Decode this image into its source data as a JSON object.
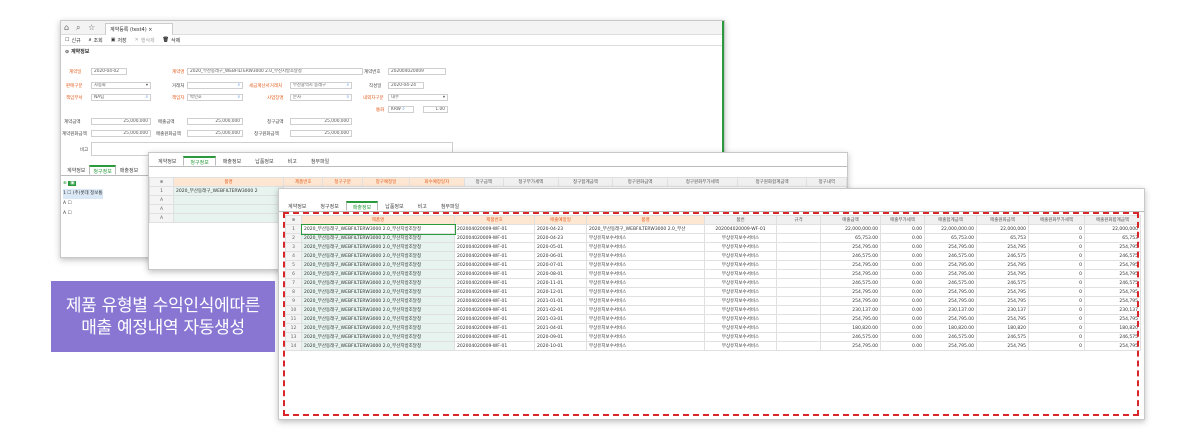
{
  "w1": {
    "doc_tab": "계약등록 (test4)",
    "toolbar": {
      "new": "신규",
      "search": "조회",
      "save": "저장",
      "delete_disabled": "행삭제",
      "delete": "삭제"
    },
    "section": "계약정보",
    "fields": {
      "contract_date_label": "계약일",
      "contract_date": "2020-04-02",
      "contract_name_label": "계약명",
      "contract_name": "2020_부산동래구_WEBFILTERW3000 2.0_부산지방조달청",
      "contract_no_label": "계약번호",
      "contract_no": "202004020009",
      "sales_type_label": "판매구분",
      "sales_type": "자동화",
      "customer_label": "거래처",
      "customer": "",
      "tax_client_label": "세금계산서거래처",
      "tax_client": "부산광역시 동래구",
      "reg_date_label": "작성일",
      "reg_date": "2020-04-24",
      "dept_label": "책임부서",
      "dept": "NA팀",
      "person_label": "책임자",
      "person": "박민호",
      "biz_label": "사업장명",
      "biz": "본사",
      "inout_label": "내외자구분",
      "inout": "내수",
      "currency_label": "통화",
      "currency": "KRW",
      "rate": "1.00",
      "contract_amt_label": "계약금액",
      "contract_amt": "25,000,000",
      "sales_amt_label": "매출금액",
      "sales_amt": "25,000,000",
      "bill_amt_label": "청구금액",
      "bill_amt": "25,000,000",
      "contract_won_label": "계약원화금액",
      "contract_won": "25,000,000",
      "sales_won_label": "매출원화금액",
      "sales_won": "25,000,000",
      "bill_total_label": "청구원화금액",
      "bill_total": "25,000,000",
      "memo_label": "비고"
    },
    "tabs": [
      "계약정보",
      "청구정보",
      "매출정보"
    ],
    "row_label": "(주)롯데 정보통"
  },
  "w2": {
    "tabs": [
      "계약정보",
      "청구정보",
      "매출정보",
      "납품정보",
      "비고",
      "첨부파일"
    ],
    "headers": [
      "품명",
      "제품번호",
      "청구구분",
      "청구예정일",
      "회수예정일자",
      "청구금액",
      "청구부가세액",
      "청구합계금액",
      "청구원화금액",
      "청구원화부가세액",
      "청구원화합계금액",
      "청구내역"
    ],
    "row1": "2020_부산동래구_WEBFILTERW3000 2"
  },
  "w3": {
    "tabs": [
      "계약정보",
      "청구정보",
      "매출정보",
      "납품정보",
      "비고",
      "첨부파일"
    ],
    "headers": [
      "제품명",
      "제품번호",
      "매출예정일",
      "품명",
      "품번",
      "규격",
      "매출금액",
      "매출부가세액",
      "매출합계금액",
      "매출원화금액",
      "매출원화부가세액",
      "매출원화합계금액"
    ],
    "rows": [
      [
        "2020_부산동래구_WEBFILTERW3000 2.0_부산지방조달청",
        "202004020009-WF-01",
        "2020-04-23",
        "2020_부산동래구_WEBFILTERW3000 2.0_부산",
        "202004020009-WF-01",
        "",
        "22,000,000.00",
        "0.00",
        "22,000,000.00",
        "22,000,000",
        "0",
        "22,000,000"
      ],
      [
        "2020_부산동래구_WEBFILTERW3000 2.0_부산지방조달청",
        "202004020009-WF-01",
        "2020-04-23",
        "무상유지보수서비스",
        "무상유지보수서비스",
        "",
        "65,753.00",
        "0.00",
        "65,753.00",
        "65,753",
        "0",
        "65,753"
      ],
      [
        "2020_부산동래구_WEBFILTERW3000 2.0_부산지방조달청",
        "202004020009-WF-01",
        "2020-05-01",
        "무상유지보수서비스",
        "무상유지보수서비스",
        "",
        "254,795.00",
        "0.00",
        "254,795.00",
        "254,795",
        "0",
        "254,795"
      ],
      [
        "2020_부산동래구_WEBFILTERW3000 2.0_부산지방조달청",
        "202004020009-WF-01",
        "2020-06-01",
        "무상유지보수서비스",
        "무상유지보수서비스",
        "",
        "246,575.00",
        "0.00",
        "246,575.00",
        "246,575",
        "0",
        "246,575"
      ],
      [
        "2020_부산동래구_WEBFILTERW3000 2.0_부산지방조달청",
        "202004020009-WF-01",
        "2020-07-01",
        "무상유지보수서비스",
        "무상유지보수서비스",
        "",
        "254,795.00",
        "0.00",
        "254,795.00",
        "254,795",
        "0",
        "254,795"
      ],
      [
        "2020_부산동래구_WEBFILTERW3000 2.0_부산지방조달청",
        "202004020009-WF-01",
        "2020-08-01",
        "무상유지보수서비스",
        "무상유지보수서비스",
        "",
        "254,795.00",
        "0.00",
        "254,795.00",
        "254,795",
        "0",
        "254,795"
      ],
      [
        "2020_부산동래구_WEBFILTERW3000 2.0_부산지방조달청",
        "202004020009-WF-01",
        "2020-11-01",
        "무상유지보수서비스",
        "무상유지보수서비스",
        "",
        "246,575.00",
        "0.00",
        "246,575.00",
        "246,575",
        "0",
        "246,575"
      ],
      [
        "2020_부산동래구_WEBFILTERW3000 2.0_부산지방조달청",
        "202004020009-WF-01",
        "2020-12-01",
        "무상유지보수서비스",
        "무상유지보수서비스",
        "",
        "254,795.00",
        "0.00",
        "254,795.00",
        "254,795",
        "0",
        "254,795"
      ],
      [
        "2020_부산동래구_WEBFILTERW3000 2.0_부산지방조달청",
        "202004020009-WF-01",
        "2021-01-01",
        "무상유지보수서비스",
        "무상유지보수서비스",
        "",
        "254,795.00",
        "0.00",
        "254,795.00",
        "254,795",
        "0",
        "254,795"
      ],
      [
        "2020_부산동래구_WEBFILTERW3000 2.0_부산지방조달청",
        "202004020009-WF-01",
        "2021-02-01",
        "무상유지보수서비스",
        "무상유지보수서비스",
        "",
        "230,137.00",
        "0.00",
        "230,137.00",
        "230,137",
        "0",
        "230,137"
      ],
      [
        "2020_부산동래구_WEBFILTERW3000 2.0_부산지방조달청",
        "202004020009-WF-01",
        "2021-03-01",
        "무상유지보수서비스",
        "무상유지보수서비스",
        "",
        "254,795.00",
        "0.00",
        "254,795.00",
        "254,795",
        "0",
        "254,795"
      ],
      [
        "2020_부산동래구_WEBFILTERW3000 2.0_부산지방조달청",
        "202004020009-WF-01",
        "2021-04-01",
        "무상유지보수서비스",
        "무상유지보수서비스",
        "",
        "180,820.00",
        "0.00",
        "180,820.00",
        "180,820",
        "0",
        "180,820"
      ],
      [
        "2020_부산동래구_WEBFILTERW3000 2.0_부산지방조달청",
        "202004020009-WF-01",
        "2020-09-01",
        "무상유지보수서비스",
        "무상유지보수서비스",
        "",
        "246,575.00",
        "0.00",
        "246,575.00",
        "246,575",
        "0",
        "246,575"
      ],
      [
        "2020_부산동래구_WEBFILTERW3000 2.0_부산지방조달청",
        "202004020009-WF-01",
        "2020-10-01",
        "무상유지보수서비스",
        "무상유지보수서비스",
        "",
        "254,795.00",
        "0.00",
        "254,795.00",
        "254,795",
        "0",
        "254,795"
      ]
    ]
  },
  "callout": {
    "line1": "제품 유형별 수익인식에따른",
    "line2": "매출 예정내역 자동생성"
  },
  "colors": {
    "accent": "#2a9a3c",
    "header_orange": "#e35c1c",
    "callout_bg": "#8976d3",
    "dash": "#d9262b"
  }
}
